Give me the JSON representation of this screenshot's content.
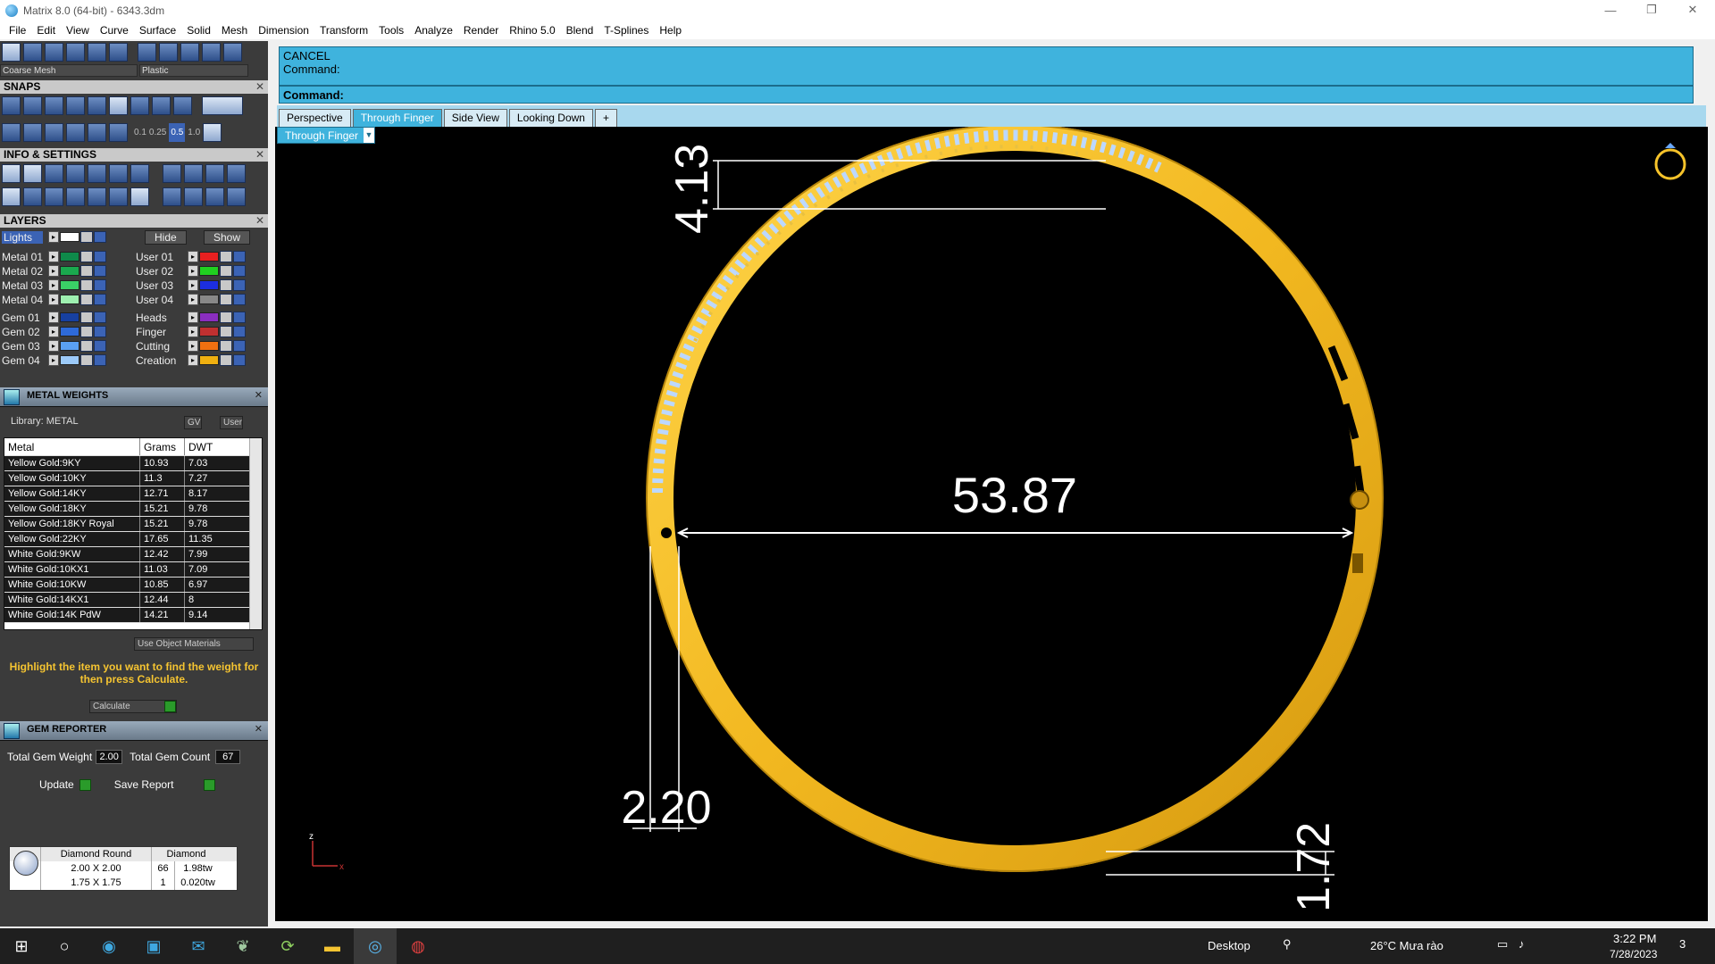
{
  "window": {
    "title": "Matrix 8.0 (64-bit) - 6343.3dm",
    "min": "—",
    "max": "❐",
    "close": "✕"
  },
  "menu": [
    "File",
    "Edit",
    "View",
    "Curve",
    "Surface",
    "Solid",
    "Mesh",
    "Dimension",
    "Transform",
    "Tools",
    "Analyze",
    "Render",
    "Rhino 5.0",
    "Blend",
    "T-Splines",
    "Help"
  ],
  "display": {
    "mesh": "Coarse Mesh",
    "material": "Plastic"
  },
  "snaps": {
    "title": "SNAPS",
    "values": [
      "0.1",
      "0.25",
      "0.5",
      "1.0"
    ]
  },
  "info": {
    "title": "INFO & SETTINGS"
  },
  "layers": {
    "title": "LAYERS",
    "lights": "Lights",
    "hide": "Hide",
    "show": "Show",
    "left": [
      {
        "name": "Metal 01",
        "color": "#0f8a4a"
      },
      {
        "name": "Metal 02",
        "color": "#1aa84e"
      },
      {
        "name": "Metal 03",
        "color": "#3ad066"
      },
      {
        "name": "Metal 04",
        "color": "#9ef0b0"
      },
      {
        "name": "Gem 01",
        "color": "#1740a0"
      },
      {
        "name": "Gem 02",
        "color": "#2e6ad8"
      },
      {
        "name": "Gem 03",
        "color": "#5aa0f2"
      },
      {
        "name": "Gem 04",
        "color": "#9ccaf8"
      }
    ],
    "right": [
      {
        "name": "User 01",
        "color": "#e82020"
      },
      {
        "name": "User 02",
        "color": "#20d020"
      },
      {
        "name": "User 03",
        "color": "#1c2ee0"
      },
      {
        "name": "User 04",
        "color": "#888888"
      },
      {
        "name": "Heads",
        "color": "#8a2ec0"
      },
      {
        "name": "Finger",
        "color": "#c03030"
      },
      {
        "name": "Cutting",
        "color": "#f07010"
      },
      {
        "name": "Creation",
        "color": "#f0b010"
      }
    ]
  },
  "metal_weights": {
    "title": "METAL WEIGHTS",
    "library": "Library: METAL",
    "gv": "GV",
    "user": "User",
    "headers": [
      "Metal",
      "Grams",
      "DWT"
    ],
    "rows": [
      [
        "Yellow Gold:9KY",
        "10.93",
        "7.03"
      ],
      [
        "Yellow Gold:10KY",
        "11.3",
        "7.27"
      ],
      [
        "Yellow Gold:14KY",
        "12.71",
        "8.17"
      ],
      [
        "Yellow Gold:18KY",
        "15.21",
        "9.78"
      ],
      [
        "Yellow Gold:18KY Royal",
        "15.21",
        "9.78"
      ],
      [
        "Yellow Gold:22KY",
        "17.65",
        "11.35"
      ],
      [
        "White Gold:9KW",
        "12.42",
        "7.99"
      ],
      [
        "White Gold:10KX1",
        "11.03",
        "7.09"
      ],
      [
        "White Gold:10KW",
        "10.85",
        "6.97"
      ],
      [
        "White Gold:14KX1",
        "12.44",
        "8"
      ],
      [
        "White Gold:14K PdW",
        "14.21",
        "9.14"
      ]
    ],
    "use_object_materials": "Use Object Materials",
    "hint": "Highlight the item you want to find the weight for then press Calculate.",
    "calculate": "Calculate"
  },
  "gem_reporter": {
    "title": "GEM REPORTER",
    "total_weight_label": "Total Gem Weight",
    "total_weight": "2.00",
    "total_count_label": "Total Gem Count",
    "total_count": "67",
    "update": "Update",
    "save_report": "Save Report",
    "head": [
      "Diamond Round",
      "Diamond"
    ],
    "rows": [
      [
        "2.00 X 2.00",
        "66",
        "1.98tw"
      ],
      [
        "1.75 X 1.75",
        "1",
        "0.020tw"
      ]
    ]
  },
  "command": {
    "line1": "CANCEL",
    "line2": "Command:",
    "prompt": "Command:"
  },
  "views": {
    "tabs": [
      "Perspective",
      "Through Finger",
      "Side View",
      "Looking Down",
      "+"
    ],
    "active": 1,
    "current": "Through Finger"
  },
  "dimensions": {
    "diameter": "53.87",
    "top": "4.13",
    "bottom_left": "2.20",
    "bottom_right": "1.72"
  },
  "axes": {
    "z": "z",
    "x": "x"
  },
  "taskbar": {
    "desktop": "Desktop",
    "weather": "26°C  Mưa rào",
    "time": "3:22 PM",
    "date": "7/28/2023",
    "notif": "3"
  },
  "colors": {
    "gold": "#f6c32a",
    "viewport": "#000000",
    "command": "#3fb3dd",
    "panel": "#3b3b3b"
  }
}
